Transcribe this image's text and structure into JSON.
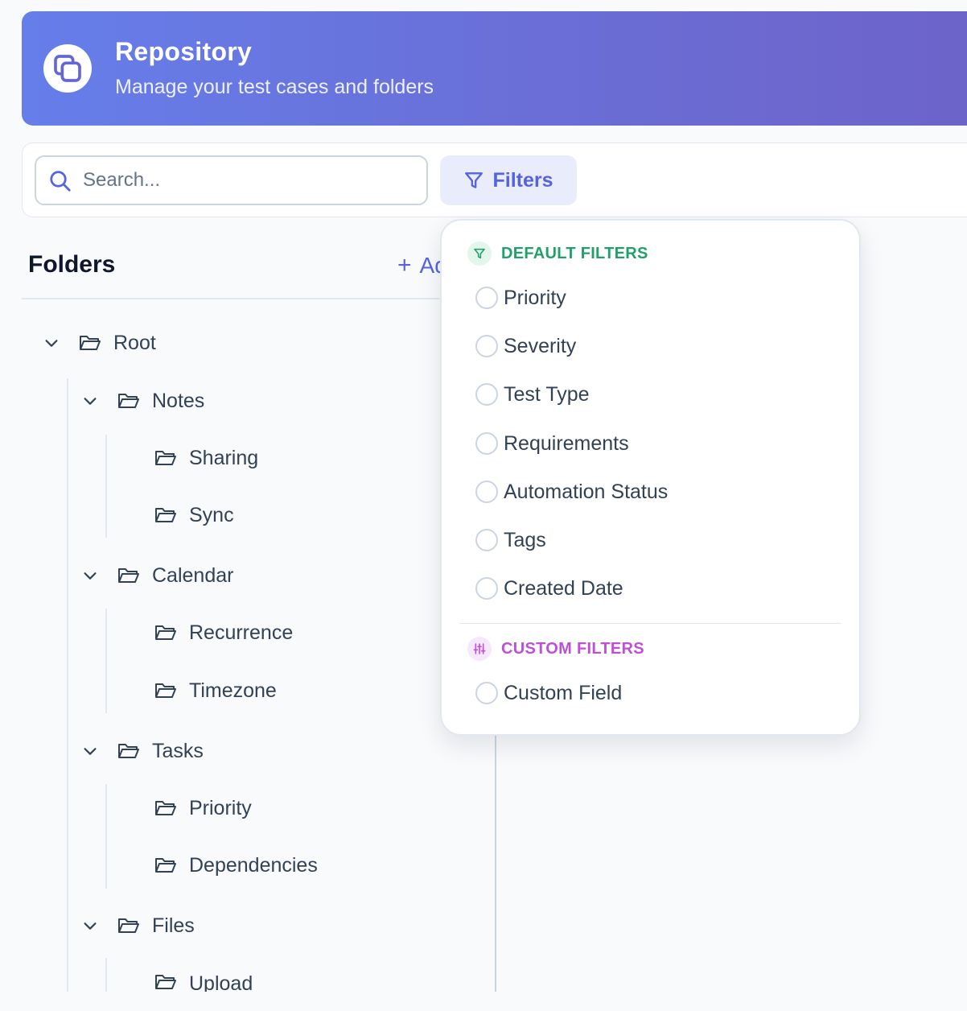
{
  "header": {
    "title": "Repository",
    "subtitle": "Manage your test cases and folders",
    "logo_icon": "copy-icon"
  },
  "toolbar": {
    "search_placeholder": "Search...",
    "filters_label": "Filters"
  },
  "folders": {
    "title": "Folders",
    "add_label": "Add",
    "tree": {
      "root": "Root",
      "notes": "Notes",
      "sharing": "Sharing",
      "sync": "Sync",
      "calendar": "Calendar",
      "recurrence": "Recurrence",
      "timezone": "Timezone",
      "tasks": "Tasks",
      "priority": "Priority",
      "dependencies": "Dependencies",
      "files": "Files",
      "upload": "Upload"
    }
  },
  "filters_dropdown": {
    "default_heading": "DEFAULT FILTERS",
    "default_options": [
      "Priority",
      "Severity",
      "Test Type",
      "Requirements",
      "Automation Status",
      "Tags",
      "Created Date"
    ],
    "custom_heading": "CUSTOM FILTERS",
    "custom_options": [
      "Custom Field"
    ]
  },
  "colors": {
    "accent": "#5563e0",
    "default_filters": "#22a06b",
    "custom_filters": "#c04fd8"
  }
}
